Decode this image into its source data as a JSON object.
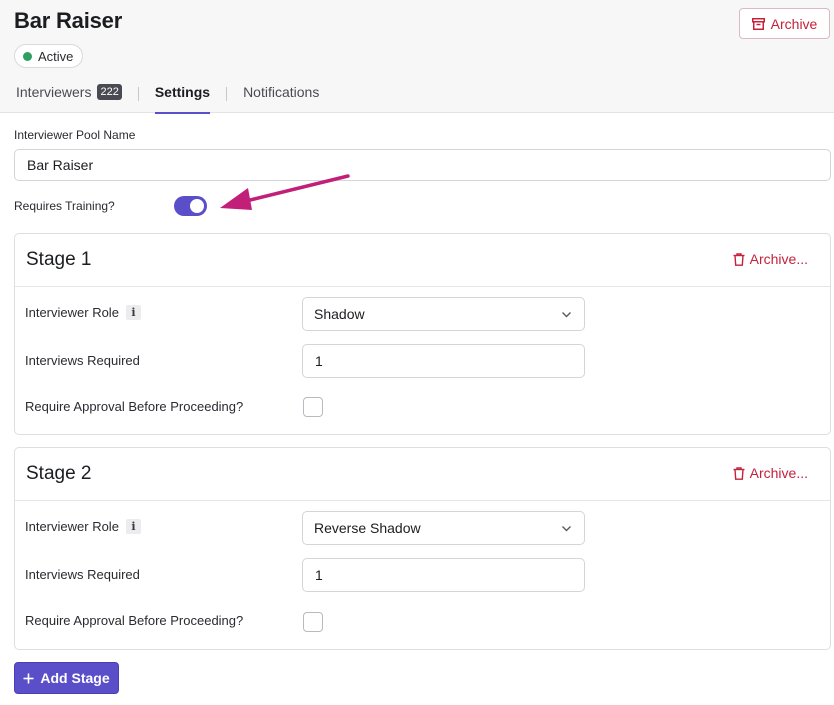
{
  "header": {
    "title": "Bar Raiser",
    "status": "Active",
    "archive_label": "Archive"
  },
  "tabs": [
    {
      "label": "Interviewers",
      "count": "222"
    },
    {
      "label": "Settings"
    },
    {
      "label": "Notifications"
    }
  ],
  "form": {
    "pool_name_label": "Interviewer Pool Name",
    "pool_name_value": "Bar Raiser",
    "requires_training_label": "Requires Training?",
    "requires_training": true
  },
  "stages": [
    {
      "title": "Stage 1",
      "archive_label": "Archive...",
      "role_label": "Interviewer Role",
      "role_value": "Shadow",
      "required_label": "Interviews Required",
      "required_value": "1",
      "approval_label": "Require Approval Before Proceeding?",
      "approval_checked": false
    },
    {
      "title": "Stage 2",
      "archive_label": "Archive...",
      "role_label": "Interviewer Role",
      "role_value": "Reverse Shadow",
      "required_label": "Interviews Required",
      "required_value": "1",
      "approval_label": "Require Approval Before Proceeding?",
      "approval_checked": false
    }
  ],
  "add_stage_label": "Add Stage",
  "colors": {
    "accent": "#5b4fc9",
    "danger": "#c4223b",
    "success": "#2e9f62",
    "annotation_arrow": "#c21f78"
  }
}
